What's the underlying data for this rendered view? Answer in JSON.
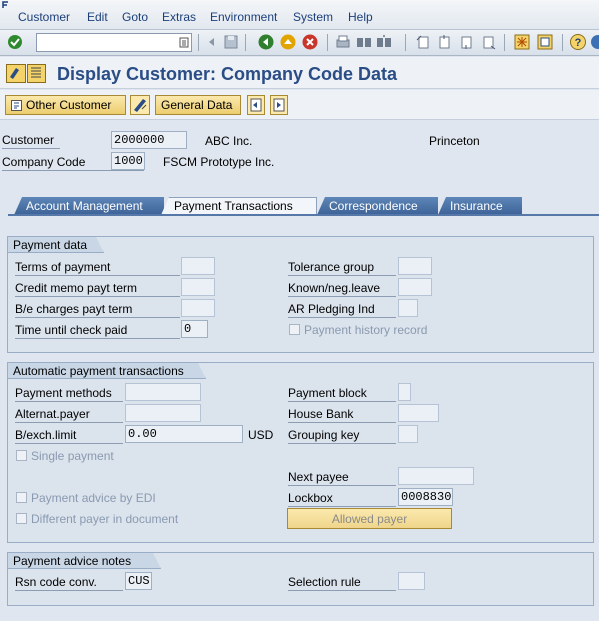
{
  "menu": [
    "Customer",
    "Edit",
    "Goto",
    "Extras",
    "Environment",
    "System",
    "Help"
  ],
  "title": "Display Customer: Company Code Data",
  "app_toolbar": {
    "other_customer": "Other Customer",
    "general_data": "General Data"
  },
  "header": {
    "customer_label": "Customer",
    "customer_value": "2000000",
    "customer_name": "ABC Inc.",
    "customer_city": "Princeton",
    "company_code_label": "Company Code",
    "company_code_value": "1000",
    "company_code_name": "FSCM Prototype Inc."
  },
  "tabs": [
    "Account Management",
    "Payment Transactions",
    "Correspondence",
    "Insurance"
  ],
  "payment_data": {
    "title": "Payment data",
    "terms_of_payment": "Terms of payment",
    "credit_memo": "Credit memo payt term",
    "be_charges": "B/e charges payt term",
    "time_until_check": "Time until check paid",
    "time_until_check_value": "0",
    "tolerance_group": "Tolerance group",
    "known_neg_leave": "Known/neg.leave",
    "ar_pledging": "AR Pledging Ind",
    "payment_history": "Payment history record"
  },
  "auto_payment": {
    "title": "Automatic payment transactions",
    "payment_methods": "Payment methods",
    "alternat_payer": "Alternat.payer",
    "bexch_limit": "B/exch.limit",
    "bexch_value": "0.00",
    "bexch_currency": "USD",
    "single_payment": "Single payment",
    "payment_advice_edi": "Payment advice by EDI",
    "different_payer": "Different payer in document",
    "payment_block": "Payment block",
    "house_bank": "House Bank",
    "grouping_key": "Grouping key",
    "next_payee": "Next payee",
    "lockbox": "Lockbox",
    "lockbox_value": "0008830",
    "allowed_payer": "Allowed payer"
  },
  "advice_notes": {
    "title": "Payment advice notes",
    "rsn_code_conv": "Rsn code conv.",
    "rsn_code_value": "CUS",
    "selection_rule": "Selection rule"
  }
}
